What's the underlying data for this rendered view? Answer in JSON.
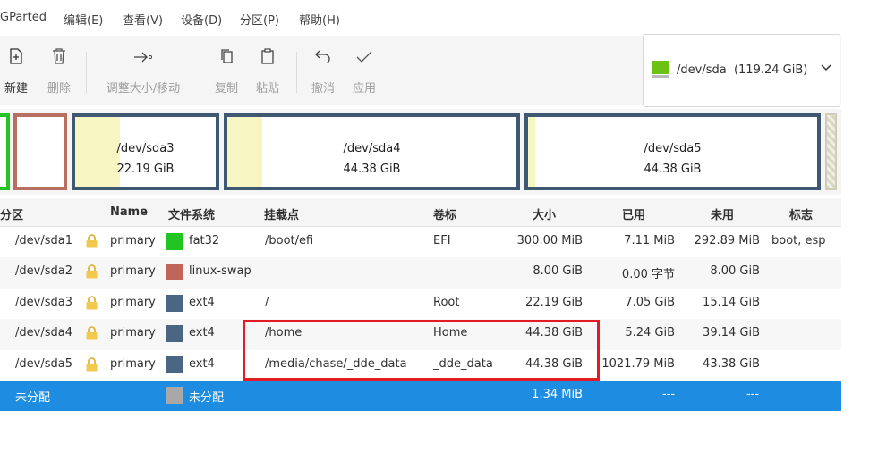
{
  "menu": {
    "app": "GParted",
    "edit": "编辑(E)",
    "view": "查看(V)",
    "device": "设备(D)",
    "partition": "分区(P)",
    "help": "帮助(H)"
  },
  "toolbar": {
    "new": "新建",
    "delete": "删除",
    "resize": "调整大小/移动",
    "copy": "复制",
    "paste": "粘贴",
    "undo": "撤消",
    "apply": "应用"
  },
  "device": {
    "name": "/dev/sda",
    "size": "(119.24 GiB)"
  },
  "map": [
    {
      "name": "/dev/sda3",
      "size": "22.19 GiB"
    },
    {
      "name": "/dev/sda4",
      "size": "44.38 GiB"
    },
    {
      "name": "/dev/sda5",
      "size": "44.38 GiB"
    }
  ],
  "columns": {
    "partition": "分区",
    "name": "Name",
    "filesystem": "文件系统",
    "mountpoint": "挂载点",
    "label": "卷标",
    "size": "大小",
    "used": "已用",
    "unused": "未用",
    "flags": "标志"
  },
  "rows": [
    {
      "partition": "/dev/sda1",
      "name": "primary",
      "fs": "fat32",
      "fs_color": "#22c422",
      "mount": "/boot/efi",
      "label": "EFI",
      "size": "300.00 MiB",
      "used": "7.11 MiB",
      "unused": "292.89 MiB",
      "flags": "boot, esp"
    },
    {
      "partition": "/dev/sda2",
      "name": "primary",
      "fs": "linux-swap",
      "fs_color": "#c0655a",
      "mount": "",
      "label": "",
      "size": "8.00 GiB",
      "used": "0.00 字节",
      "unused": "8.00 GiB",
      "flags": ""
    },
    {
      "partition": "/dev/sda3",
      "name": "primary",
      "fs": "ext4",
      "fs_color": "#4a6682",
      "mount": "/",
      "label": "Root",
      "size": "22.19 GiB",
      "used": "7.05 GiB",
      "unused": "15.14 GiB",
      "flags": ""
    },
    {
      "partition": "/dev/sda4",
      "name": "primary",
      "fs": "ext4",
      "fs_color": "#4a6682",
      "mount": "/home",
      "label": "Home",
      "size": "44.38 GiB",
      "used": "5.24 GiB",
      "unused": "39.14 GiB",
      "flags": ""
    },
    {
      "partition": "/dev/sda5",
      "name": "primary",
      "fs": "ext4",
      "fs_color": "#4a6682",
      "mount": "/media/chase/_dde_data",
      "label": "_dde_data",
      "size": "44.38 GiB",
      "used": "1021.79 MiB",
      "unused": "43.38 GiB",
      "flags": ""
    }
  ],
  "unallocated": {
    "partition": "未分配",
    "fs": "未分配",
    "fs_color": "#a8a8a8",
    "size": "1.34 MiB",
    "used": "---",
    "unused": "---"
  }
}
